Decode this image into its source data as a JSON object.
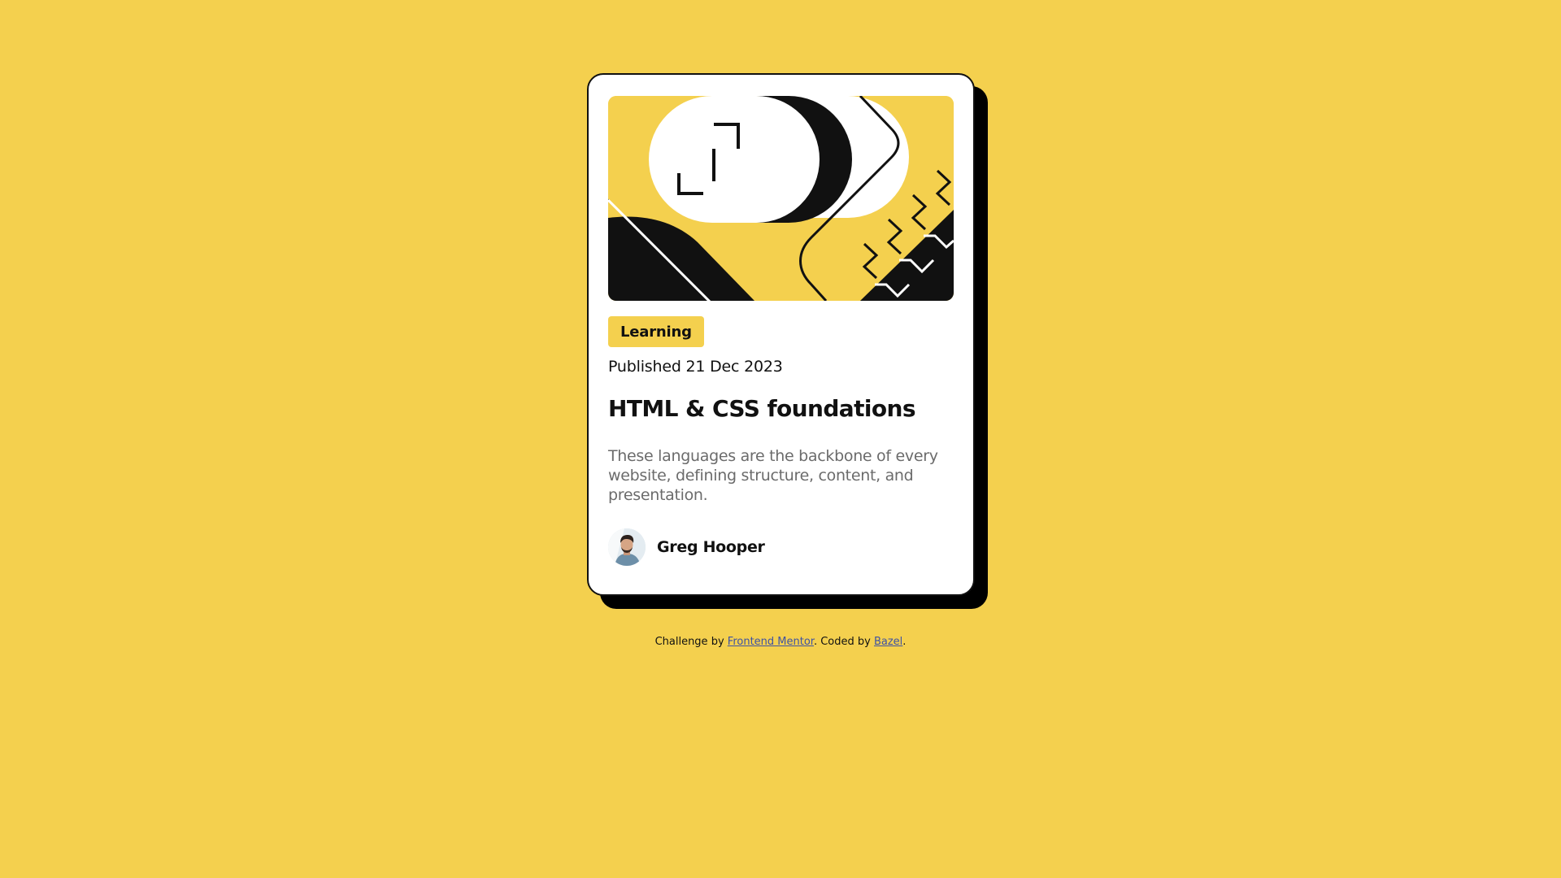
{
  "page": {
    "background_color": "#F4D04E",
    "accent_color": "#F4D04E"
  },
  "card": {
    "image_name": "illustration-article",
    "category": "Learning",
    "published": "Published 21 Dec 2023",
    "title": "HTML & CSS foundations",
    "description": "These languages are the backbone of every website, defining structure, content, and presentation.",
    "author": {
      "name": "Greg Hooper",
      "avatar_icon": "avatar-photo"
    }
  },
  "attribution": {
    "prefix": "Challenge by ",
    "link1_text": "Frontend Mentor",
    "middle": ". Coded by ",
    "link2_text": "Bazel",
    "suffix": "."
  }
}
